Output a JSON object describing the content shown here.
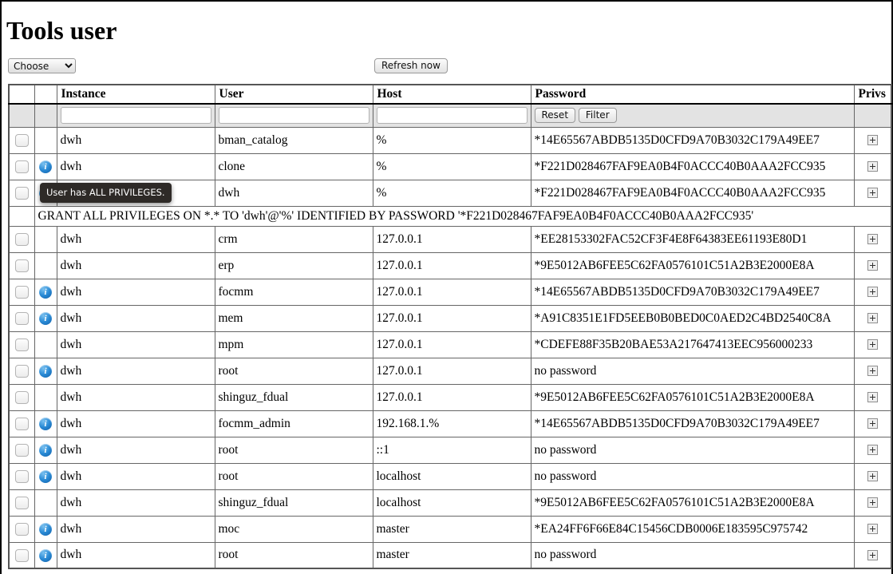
{
  "page": {
    "title": "Tools user"
  },
  "toolbar": {
    "instance_select_value": "Choose",
    "instance_select_options": [
      "Choose"
    ],
    "refresh_label": "Refresh now"
  },
  "table": {
    "headers": {
      "check": "",
      "info": "",
      "instance": "Instance",
      "user": "User",
      "host": "Host",
      "password": "Password",
      "privs": "Privs"
    },
    "filter_row": {
      "instance_value": "",
      "user_value": "",
      "host_value": "",
      "reset_label": "Reset",
      "filter_label": "Filter"
    },
    "rows": [
      {
        "info": false,
        "instance": "dwh",
        "user": "bman_catalog",
        "host": "%",
        "password": "*14E65567ABDB5135D0CFD9A70B3032C179A49EE7",
        "privs": "expand"
      },
      {
        "info": true,
        "instance": "dwh",
        "user": "clone",
        "host": "%",
        "password": "*F221D028467FAF9EA0B4F0ACCC40B0AAA2FCC935",
        "privs": "expand"
      },
      {
        "info": true,
        "instance": "dwh",
        "user": "dwh",
        "host": "%",
        "password": "*F221D028467FAF9EA0B4F0ACCC40B0AAA2FCC935",
        "privs": "expand"
      },
      {
        "grant": "GRANT ALL PRIVILEGES ON *.* TO 'dwh'@'%' IDENTIFIED BY PASSWORD '*F221D028467FAF9EA0B4F0ACCC40B0AAA2FCC935'"
      },
      {
        "info": false,
        "instance": "dwh",
        "user": "crm",
        "host": "127.0.0.1",
        "password": "*EE28153302FAC52CF3F4E8F64383EE61193E80D1",
        "privs": "expand"
      },
      {
        "info": false,
        "instance": "dwh",
        "user": "erp",
        "host": "127.0.0.1",
        "password": "*9E5012AB6FEE5C62FA0576101C51A2B3E2000E8A",
        "privs": "expand"
      },
      {
        "info": true,
        "instance": "dwh",
        "user": "focmm",
        "host": "127.0.0.1",
        "password": "*14E65567ABDB5135D0CFD9A70B3032C179A49EE7",
        "privs": "expand"
      },
      {
        "info": true,
        "instance": "dwh",
        "user": "mem",
        "host": "127.0.0.1",
        "password": "*A91C8351E1FD5EEB0B0BED0C0AED2C4BD2540C8A",
        "privs": "expand"
      },
      {
        "info": false,
        "instance": "dwh",
        "user": "mpm",
        "host": "127.0.0.1",
        "password": "*CDEFE88F35B20BAE53A217647413EEC956000233",
        "privs": "expand"
      },
      {
        "info": true,
        "instance": "dwh",
        "user": "root",
        "host": "127.0.0.1",
        "password": "no password",
        "privs": "expand"
      },
      {
        "info": false,
        "instance": "dwh",
        "user": "shinguz_fdual",
        "host": "127.0.0.1",
        "password": "*9E5012AB6FEE5C62FA0576101C51A2B3E2000E8A",
        "privs": "expand"
      },
      {
        "info": true,
        "instance": "dwh",
        "user": "focmm_admin",
        "host": "192.168.1.%",
        "password": "*14E65567ABDB5135D0CFD9A70B3032C179A49EE7",
        "privs": "expand"
      },
      {
        "info": true,
        "instance": "dwh",
        "user": "root",
        "host": "::1",
        "password": "no password",
        "privs": "expand"
      },
      {
        "info": true,
        "instance": "dwh",
        "user": "root",
        "host": "localhost",
        "password": "no password",
        "privs": "expand"
      },
      {
        "info": false,
        "instance": "dwh",
        "user": "shinguz_fdual",
        "host": "localhost",
        "password": "*9E5012AB6FEE5C62FA0576101C51A2B3E2000E8A",
        "privs": "expand"
      },
      {
        "info": true,
        "instance": "dwh",
        "user": "moc",
        "host": "master",
        "password": "*EA24FF6F66E84C15456CDB0006E183595C975742",
        "privs": "expand"
      },
      {
        "info": true,
        "instance": "dwh",
        "user": "root",
        "host": "master",
        "password": "no password",
        "privs": "expand"
      }
    ]
  },
  "tooltip": {
    "text": "User has ALL PRIVILEGES.",
    "background": "#2e2a27",
    "color": "#ffffff"
  },
  "icons": {
    "info": "i",
    "expand": "plus-box-icon",
    "select_chevron": "chevron-down-icon"
  },
  "colors": {
    "filter_row_background": "#e3e3e3",
    "info_icon_blue": "#2a8bd6",
    "table_border": "#555555"
  }
}
